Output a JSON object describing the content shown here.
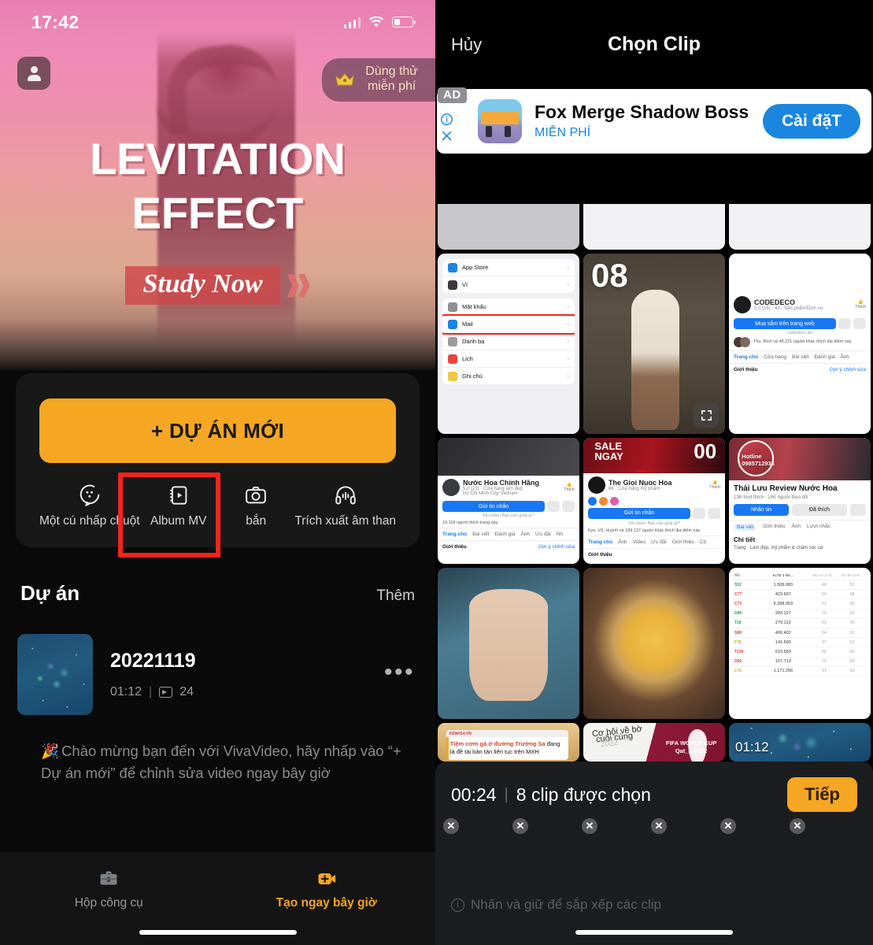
{
  "left": {
    "status": {
      "time": "17:42",
      "signal_icon": "cellular-signal-icon",
      "wifi_icon": "wifi-icon",
      "battery_icon": "battery-icon"
    },
    "avatar_icon": "account-avatar-icon",
    "trial_badge": {
      "icon": "crown-icon",
      "line1": "Dùng thử",
      "line2": "miễn phí"
    },
    "hero": {
      "line1": "LEVITATION",
      "line2": "EFFECT",
      "cta": "Study Now",
      "chevron_icon": "double-chevron-right-icon"
    },
    "new_project_button": "+ DỰ ÁN MỚI",
    "quick_actions": [
      {
        "label": "Một cú nhấp chuột",
        "icon": "one-click-template-icon"
      },
      {
        "label": "Album MV",
        "icon": "album-mv-icon"
      },
      {
        "label": "bắn",
        "icon": "camera-icon"
      },
      {
        "label": "Trích xuất âm than",
        "icon": "extract-audio-icon"
      }
    ],
    "projects_section": {
      "title": "Dự án",
      "more": "Thêm"
    },
    "project": {
      "name": "20221119",
      "duration": "01:12",
      "separator": "|",
      "clip_count": "24",
      "clip_icon": "clip-count-icon",
      "menu_icon": "more-options-icon"
    },
    "welcome": {
      "emoji": "🎉",
      "text": "Chào mừng bạn đến với VivaVideo, hãy nhấp vào “+ Dự án mới” để chỉnh sửa video ngay bây giờ"
    },
    "bottom_nav": [
      {
        "label": "Hộp công cụ",
        "icon": "toolbox-icon",
        "active": false
      },
      {
        "label": "Tạo ngay bây giờ",
        "icon": "create-now-icon",
        "active": true
      }
    ],
    "highlight_color": "#f4231f",
    "accent_color": "#f5a623"
  },
  "right": {
    "header": {
      "cancel": "Hủy",
      "title": "Chọn Clip"
    },
    "ad": {
      "tag": "AD",
      "info_icon": "info-icon",
      "close_icon": "close-icon",
      "title": "Fox Merge Shadow Boss",
      "subtitle": "MIỄN PHÍ",
      "cta": "Cài đặT",
      "thumb_icon": "app-icon"
    },
    "grid": [
      {
        "name": "partial-sheet-gray",
        "kind": "sheet-gray",
        "selected": false,
        "badge": "",
        "duration": ""
      },
      {
        "name": "partial-sheet-white-1",
        "kind": "sheet",
        "selected": false,
        "badge": "",
        "duration": ""
      },
      {
        "name": "partial-sheet-white-2",
        "kind": "sheet",
        "selected": false,
        "badge": "",
        "duration": ""
      },
      {
        "name": "ios-settings-screenshot",
        "kind": "ios",
        "selected": false,
        "badge": "",
        "duration": ""
      },
      {
        "name": "woman-white-top-video",
        "kind": "person",
        "selected": true,
        "badge": "08",
        "duration": "",
        "expand_icon": "expand-preview-icon"
      },
      {
        "name": "codedeco-facebook-page",
        "kind": "fb-codedeco",
        "selected": false,
        "badge": "",
        "duration": ""
      },
      {
        "name": "nuoc-hoa-chinh-hang-page",
        "kind": "fb-nuochoa",
        "selected": false,
        "badge": "",
        "duration": ""
      },
      {
        "name": "the-gioi-nuoc-hoa-page",
        "kind": "fb-thegioi",
        "selected": false,
        "badge": "",
        "duration": ""
      },
      {
        "name": "thai-luu-review-nuoc-hoa-page",
        "kind": "fb-thailuu",
        "selected": false,
        "badge": "",
        "duration": ""
      },
      {
        "name": "beige-blouse-product",
        "kind": "blouse",
        "selected": false,
        "badge": "",
        "duration": ""
      },
      {
        "name": "street-food-dish",
        "kind": "food",
        "selected": false,
        "badge": "",
        "duration": ""
      },
      {
        "name": "spreadsheet-table",
        "kind": "table",
        "selected": false,
        "badge": "",
        "duration": ""
      },
      {
        "name": "chicken-rice-news",
        "kind": "news",
        "selected": false,
        "badge": "",
        "duration": ""
      },
      {
        "name": "fifa-world-cup-qatar-2022",
        "kind": "worldcup",
        "selected": false,
        "badge": "",
        "duration": ""
      },
      {
        "name": "night-sky-video",
        "kind": "night",
        "selected": false,
        "badge": "",
        "duration": "01:12"
      }
    ],
    "grid_text": {
      "ios": {
        "items": [
          {
            "label": "App Store",
            "color": "#1a86e0"
          },
          {
            "label": "Ví",
            "color": "#3a3a3c"
          },
          {
            "label": "Mật khẩu",
            "color": "#8e8e93"
          },
          {
            "label": "Mail",
            "color": "#1a86e0"
          },
          {
            "label": "Danh bạ",
            "color": "#9b9b9f"
          },
          {
            "label": "Lịch",
            "color": "#e8453c"
          },
          {
            "label": "Ghi chú",
            "color": "#f2c744"
          }
        ],
        "highlighted": "Mail"
      },
      "codedeco": {
        "name": "CODEDECO",
        "meta": "5,0 (16) · 43 · Sản phẩm/Dịch vụ",
        "cta": "Mua sắm trên trang web",
        "site": "codedeco.art",
        "likes": "Thu, Bích và 48.221 người khác thích địa điểm này",
        "like_label": "Thích",
        "tabs": [
          "Trang chủ",
          "Cửa hàng",
          "Bài viết",
          "Đánh giá",
          "Ảnh"
        ],
        "about": "Giới thiệu",
        "edit": "Gợi ý chỉnh sửa"
      },
      "nuochoa": {
        "name": "Nước Hoa Chính Hãng",
        "meta": "5,0 (21) · Cửa hàng làm đẹp",
        "meta2": "Ho Chi Minh City, Vietnam",
        "cta": "Gửi tin nhắn",
        "greet": "Xin chào! Bạn cần giúp gì?",
        "likes": "10.118 người thích trang này",
        "like_label": "Thích",
        "tabs": [
          "Trang chủ",
          "Bài viết",
          "Đánh giá",
          "Ảnh",
          "Ưu đãi",
          "Nh"
        ],
        "about": "Giới thiệu",
        "edit": "Gợi ý chỉnh sửa"
      },
      "thegioi": {
        "name": "The Gioi Nuoc Hoa",
        "meta": "88 · Cửa hàng mỹ phẩm",
        "cta": "Gửi tin nhắn",
        "greet": "Xin chào! Bạn cần giúp gì?",
        "likes": "Kyo, Vũ, Huỳnh và 189.137 người khác thích địa điểm này",
        "like_label": "Thích",
        "tabs": [
          "Trang chủ",
          "Ảnh",
          "Video",
          "Ưu đãi",
          "Giới thiệu",
          "Cộ"
        ],
        "about": "Giới thiệu"
      },
      "thailuu": {
        "name": "Thái Lưu Review Nước Hoa",
        "meta": "13K lượt thích · 14K người theo dõi",
        "cta1": "Nhắn tin",
        "cta2": "Đã thích",
        "tabs": [
          "Bài viết",
          "Giới thiệu",
          "Ảnh",
          "Lượt nhắc"
        ],
        "detail": "Chi tiết",
        "detail2": "Trang · Làm đẹp, mỹ phẩm & chăm sóc cá"
      },
      "hotline": {
        "text": "Hotline",
        "number": "0985712936"
      },
      "sale": {
        "word": "SALE",
        "word2": "NGAY",
        "num": "00"
      },
      "news": {
        "source": "KENH14.VN",
        "headline_red": "Tiệm cơm gà ở đường Trường Sa",
        "headline_rest": " đang là đề tài bàn tán liên tục trên MXH"
      },
      "worldcup": {
        "l1": "Cơ hội về bờ",
        "l2": "cuối cùng",
        "l3": "2022",
        "footer1": "FIFA WORLD CUP",
        "footer2": "Qat_ar2022"
      },
      "table_rows": [
        {
          "c0": "S52",
          "c1": "1.506.983",
          "c2": "48",
          "c3": "53"
        },
        {
          "c0": "C77",
          "c1": "423.697",
          "c2": "50",
          "c3": "98"
        },
        {
          "c0": "C73",
          "c1": "5.288.053",
          "c2": "51",
          "c3": "90"
        },
        {
          "c0": "D80",
          "c1": "283.127",
          "c2": "79",
          "c3": "92"
        },
        {
          "c0": "T28",
          "c1": "279.122",
          "c2": "53",
          "c3": "99"
        },
        {
          "c0": "S88",
          "c1": "406.402",
          "c2": "64",
          "c3": "91"
        },
        {
          "c0": "F78",
          "c1": "141.690",
          "c2": "37",
          "c3": "97"
        },
        {
          "c0": "T234",
          "c1": "619.659",
          "c2": "66",
          "c3": "92"
        },
        {
          "c0": "D66",
          "c1": "107.713",
          "c2": "76",
          "c3": "89"
        },
        {
          "c0": "L73",
          "c1": "1.171.256",
          "c2": "91",
          "c3": "93"
        }
      ],
      "table_headers": [
        "Mã",
        "KLTB 3 thá…",
        "RO bn (1 th…",
        "RO bn (3 th…",
        "ROden (7…"
      ]
    },
    "selection": {
      "time": "00:24",
      "divider": "|",
      "count_label": "8 clip được chọn",
      "next_button": "Tiếp",
      "hint": "Nhấn và giữ để sắp xếp các clip",
      "hint_icon": "info-circle-icon",
      "remove_icon": "remove-clip-icon",
      "items": [
        {
          "name": "clip-1-beige-dress",
          "swatch": "g1"
        },
        {
          "name": "clip-2-white-dress",
          "swatch": "g2"
        },
        {
          "name": "clip-3-street-outfit",
          "swatch": "g3"
        },
        {
          "name": "clip-4-red-dress",
          "swatch": "g4"
        },
        {
          "name": "clip-5-black-dress",
          "swatch": "g5"
        },
        {
          "name": "clip-6-white-top",
          "swatch": "g6"
        }
      ]
    },
    "accent_color": "#f5a623",
    "link_color": "#1a86e0"
  }
}
